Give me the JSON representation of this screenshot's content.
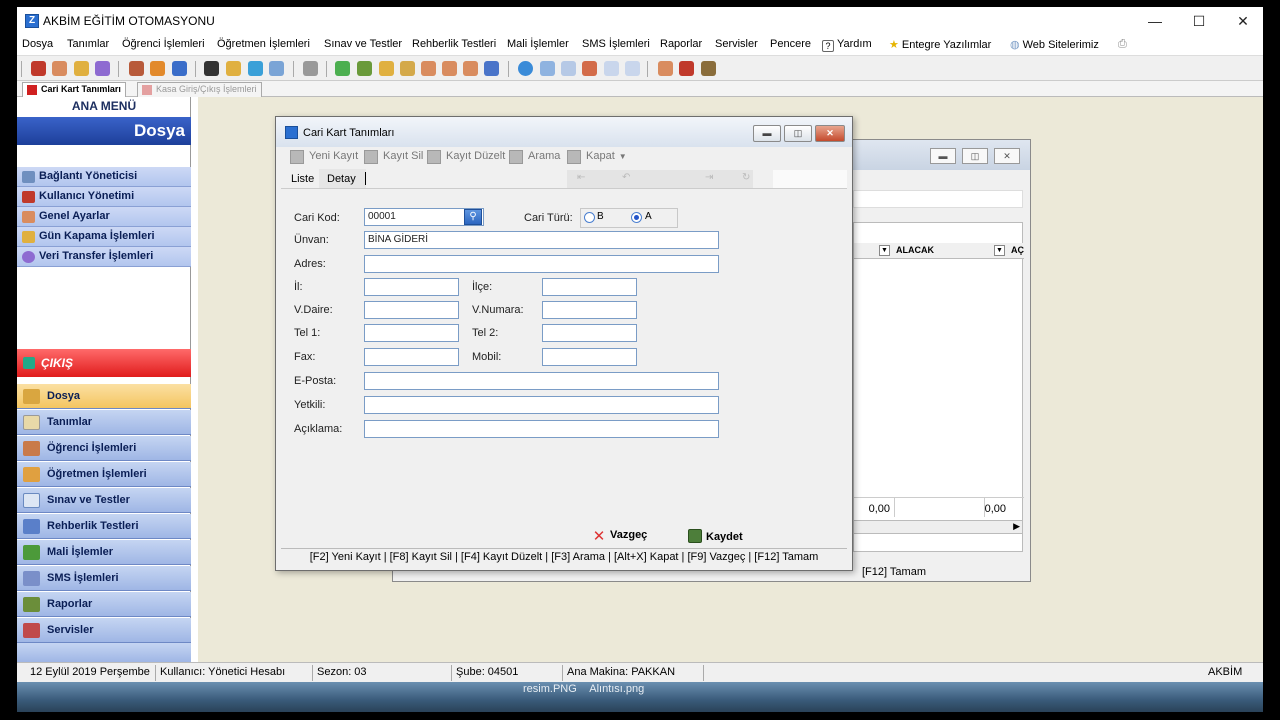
{
  "app": {
    "title": "AKBİM EĞİTİM OTOMASYONU"
  },
  "menubar": {
    "items": [
      "Dosya",
      "Tanımlar",
      "Öğrenci İşlemleri",
      "Öğretmen İşlemleri",
      "Sınav ve Testler",
      "Rehberlik Testleri",
      "Mali İşlemler",
      "SMS İşlemleri",
      "Raporlar",
      "Servisler",
      "Pencere",
      "Yardım",
      "Entegre Yazılımlar",
      "Web Sitelerimiz"
    ]
  },
  "tabs": [
    {
      "label": "Cari Kart Tanımları"
    },
    {
      "label": "Kasa Giriş/Çıkış İşlemleri"
    }
  ],
  "leftpanel": {
    "header": "ANA MENÜ",
    "section_title": "Dosya",
    "sub_items": [
      "Bağlantı Yöneticisi",
      "Kullanıcı Yönetimi",
      "Genel Ayarlar",
      "Gün Kapama İşlemleri",
      "Veri Transfer İşlemleri"
    ],
    "exit_label": "ÇIKIŞ",
    "nav_items": [
      "Dosya",
      "Tanımlar",
      "Öğrenci İşlemleri",
      "Öğretmen İşlemleri",
      "Sınav ve Testler",
      "Rehberlik Testleri",
      "Mali İşlemler",
      "SMS İşlemleri",
      "Raporlar",
      "Servisler"
    ]
  },
  "background_window": {
    "column_alacak": "ALACAK",
    "column_partial": "AÇ",
    "total_1": "0,00",
    "total_2": "0,00",
    "status_text": "[F12] Tamam"
  },
  "dialog": {
    "title": "Cari Kart Tanımları",
    "toolbar": [
      "Yeni Kayıt",
      "Kayıt Sil",
      "Kayıt Düzelt",
      "Arama",
      "Kapat"
    ],
    "tab_liste": "Liste",
    "tab_detay": "Detay",
    "fields": {
      "cari_kod_label": "Cari Kod:",
      "cari_kod_value": "00001",
      "cari_turu_label": "Cari Türü:",
      "radio_b": "B",
      "radio_a": "A",
      "unvan_label": "Ünvan:",
      "unvan_value": "BİNA GİDERİ",
      "adres_label": "Adres:",
      "il_label": "İl:",
      "ilce_label": "İlçe:",
      "vdaire_label": "V.Daire:",
      "vnumara_label": "V.Numara:",
      "tel1_label": "Tel 1:",
      "tel2_label": "Tel 2:",
      "fax_label": "Fax:",
      "mobil_label": "Mobil:",
      "eposta_label": "E-Posta:",
      "yetkili_label": "Yetkili:",
      "aciklama_label": "Açıklama:"
    },
    "cancel_label": "Vazgeç",
    "save_label": "Kaydet",
    "status_text": "[F2] Yeni Kayıt | [F8] Kayıt Sil | [F4] Kayıt Düzelt | [F3] Arama | [Alt+X] Kapat | [F9] Vazgeç | [F12] Tamam"
  },
  "statusbar": {
    "date": "12 Eylül 2019 Perşembe",
    "user": "Kullanıcı: Yönetici Hesabı",
    "season": "Sezon: 03",
    "branch": "Şube: 04501",
    "machine": "Ana Makina: PAKKAN",
    "brand": "AKBİM"
  },
  "desktop": {
    "label_1": "resim.PNG",
    "label_2": "Alıntısı.png"
  }
}
